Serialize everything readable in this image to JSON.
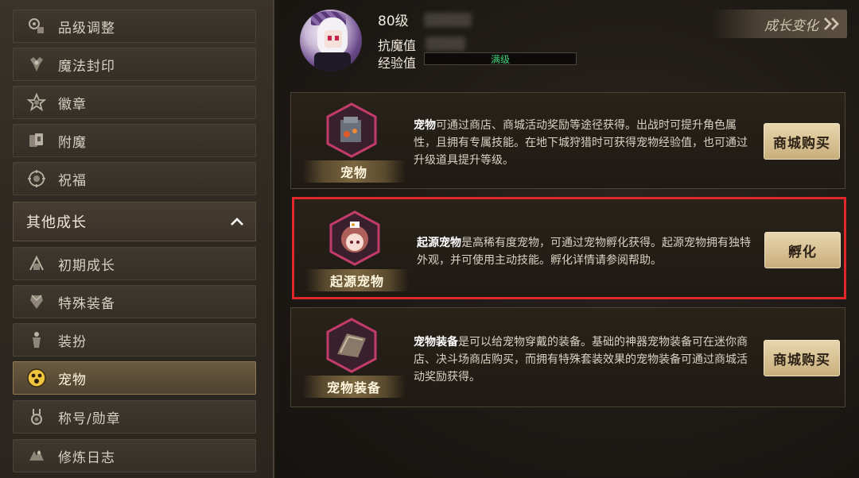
{
  "sidebar": {
    "items_top": [
      {
        "label": "品级调整",
        "icon": "gem-upgrade-icon"
      },
      {
        "label": "魔法封印",
        "icon": "magic-seal-icon"
      },
      {
        "label": "徽章",
        "icon": "emblem-icon"
      },
      {
        "label": "附魔",
        "icon": "enchant-card-icon"
      },
      {
        "label": "祝福",
        "icon": "blessing-icon"
      }
    ],
    "section_header": "其他成长",
    "items_bottom": [
      {
        "label": "初期成长",
        "icon": "initial-growth-icon"
      },
      {
        "label": "特殊装备",
        "icon": "special-equipment-icon"
      },
      {
        "label": "装扮",
        "icon": "costume-icon"
      },
      {
        "label": "宠物",
        "icon": "pet-icon",
        "active": true
      },
      {
        "label": "称号/勋章",
        "icon": "title-medal-icon"
      },
      {
        "label": "修炼日志",
        "icon": "training-log-icon"
      }
    ]
  },
  "character": {
    "level": "80级",
    "stat_magic_resist_label": "抗魔值",
    "stat_exp_label": "经验值",
    "exp_status": "满级"
  },
  "growth_button": {
    "label": "成长变化"
  },
  "cards": [
    {
      "title": "宠物",
      "desc_bold": "宠物",
      "desc_rest": "可通过商店、商城活动奖励等途径获得。出战时可提升角色属性，且拥有专属技能。在地下城狩猎时可获得宠物经验值，也可通过升级道具提升等级。",
      "button": "商城购买",
      "icon": "pet-rock-icon"
    },
    {
      "title": "起源宠物",
      "desc_bold": "起源宠物",
      "desc_rest": "是高稀有度宠物，可通过宠物孵化获得。起源宠物拥有独特外观，并可使用主动技能。孵化详情请参阅帮助。",
      "button": "孵化",
      "icon": "origin-pet-girl-icon"
    },
    {
      "title": "宠物装备",
      "desc_bold": "宠物装备",
      "desc_rest": "是可以给宠物穿戴的装备。基础的神器宠物装备可在迷你商店、决斗场商店购买，而拥有特殊套装效果的宠物装备可通过商城活动奖励获得。",
      "button": "商城购买",
      "icon": "pet-equipment-icon"
    }
  ],
  "colors": {
    "highlight_border": "#e0282a",
    "button_gold": "#d9c08f",
    "exp_text": "#3fd17a"
  }
}
